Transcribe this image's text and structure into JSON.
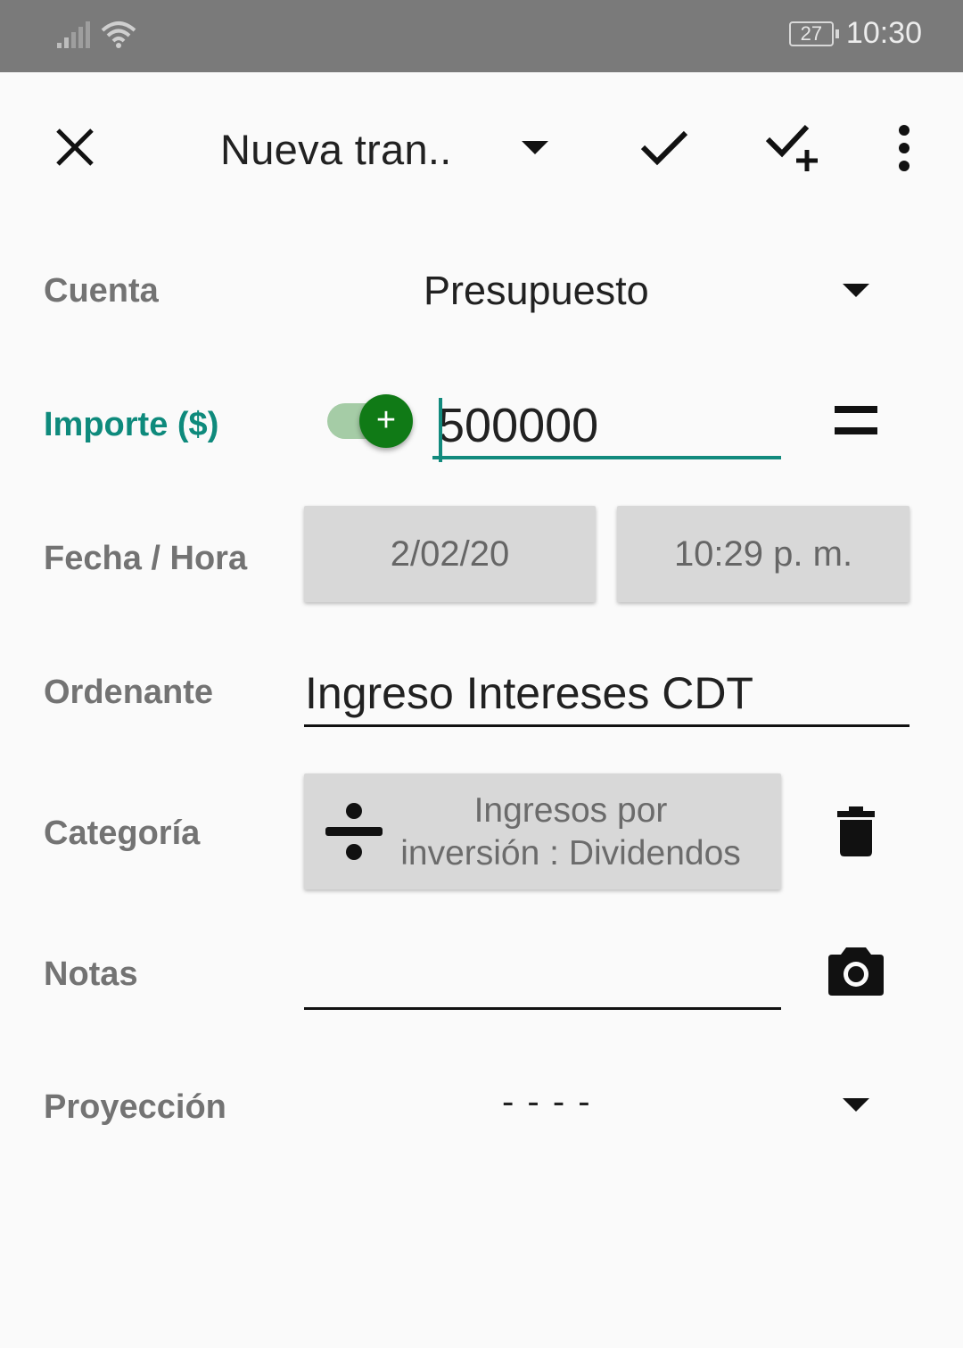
{
  "status_bar": {
    "battery": "27",
    "time": "10:30"
  },
  "toolbar": {
    "title": "Nueva tran..",
    "icons": [
      "close-icon",
      "dropdown-caret-icon",
      "check-icon",
      "check-plus-icon",
      "more-vert-icon"
    ]
  },
  "form": {
    "account": {
      "label": "Cuenta",
      "value": "Presupuesto"
    },
    "amount": {
      "label": "Importe ($)",
      "value": "500000",
      "sign": "+",
      "toggle_on": true,
      "accent": "#128a7d"
    },
    "datetime": {
      "label": "Fecha / Hora",
      "date": "2/02/20",
      "time": "10:29 p. m."
    },
    "payee": {
      "label": "Ordenante",
      "value": "Ingreso Intereses CDT"
    },
    "category": {
      "label": "Categoría",
      "line1": "Ingresos por",
      "line2": "inversión : Dividendos"
    },
    "notes": {
      "label": "Notas",
      "value": ""
    },
    "projection": {
      "label": "Proyección",
      "value": "- - - -"
    }
  }
}
